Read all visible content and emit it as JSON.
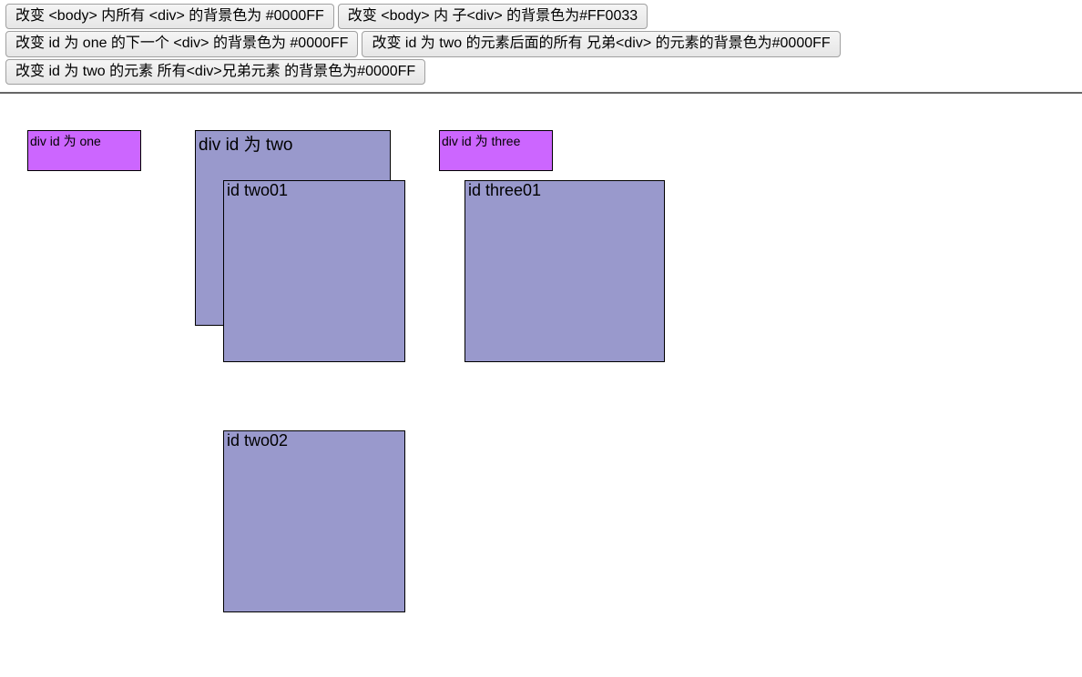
{
  "buttons": {
    "b1": "改变 <body> 内所有 <div> 的背景色为 #0000FF",
    "b2": "改变 <body> 内 子<div> 的背景色为#FF0033",
    "b3": "改变 id 为 one 的下一个 <div> 的背景色为 #0000FF",
    "b4": "改变 id 为 two 的元素后面的所有 兄弟<div> 的元素的背景色为#0000FF",
    "b5": "改变 id 为 two 的元素 所有<div>兄弟元素 的背景色为#0000FF"
  },
  "boxes": {
    "one": "div id 为 one",
    "two": "div id 为 two",
    "two01": "id two01",
    "two02": "id two02",
    "three": "div id 为 three",
    "three01": "id three01"
  }
}
